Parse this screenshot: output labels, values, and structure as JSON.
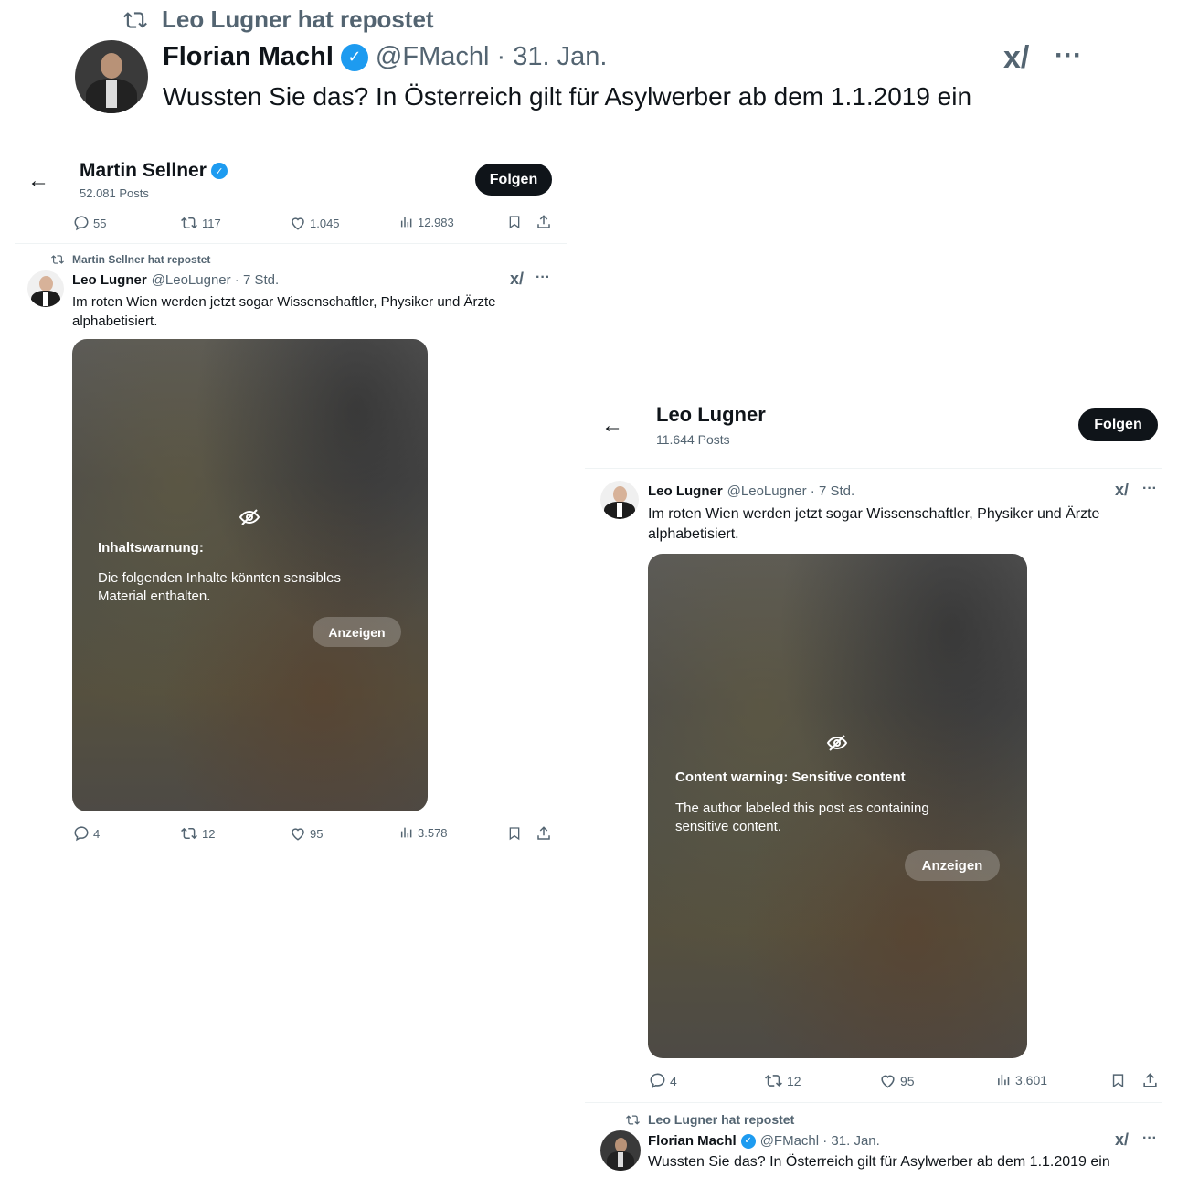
{
  "top": {
    "repost_label": "Leo Lugner hat repostet",
    "author_name": "Florian Machl",
    "handle_date": "@FMachl · 31. Jan.",
    "text": "Wussten Sie das? In Österreich gilt für Asylwerber ab dem 1.1.2019 ein"
  },
  "left": {
    "header_name": "Martin Sellner",
    "header_posts": "52.081 Posts",
    "follow_label": "Folgen",
    "first_actions": {
      "replies": "55",
      "reposts": "117",
      "likes": "1.045",
      "views": "12.983"
    },
    "repost_label": "Martin Sellner hat repostet",
    "author_name": "Leo Lugner",
    "handle_time": "@LeoLugner · 7 Std.",
    "text": "Im roten Wien werden jetzt sogar Wissenschaftler, Physiker und Ärzte alphabetisiert.",
    "warning_title": "Inhaltswarnung:",
    "warning_text": "Die folgenden Inhalte könnten sensibles Material enthalten.",
    "show_label": "Anzeigen",
    "actions": {
      "replies": "4",
      "reposts": "12",
      "likes": "95",
      "views": "3.578"
    }
  },
  "right": {
    "header_name": "Leo Lugner",
    "header_posts": "11.644 Posts",
    "follow_label": "Folgen",
    "author_name": "Leo Lugner",
    "handle_time": "@LeoLugner · 7 Std.",
    "text": "Im roten Wien werden jetzt sogar Wissenschaftler, Physiker und Ärzte alphabetisiert.",
    "warning_title": "Content warning: Sensitive content",
    "warning_text": "The author labeled this post as containing sensitive content.",
    "show_label": "Anzeigen",
    "actions": {
      "replies": "4",
      "reposts": "12",
      "likes": "95",
      "views": "3.601"
    },
    "repost_label": "Leo Lugner hat repostet",
    "bottom_author": "Florian Machl",
    "bottom_handle_date": "@FMachl · 31. Jan.",
    "bottom_text": "Wussten Sie das? In Österreich gilt für Asylwerber ab dem 1.1.2019 ein"
  },
  "icons": {
    "repost": "repost-icon",
    "reply": "reply-icon",
    "like": "heart-icon",
    "views": "views-icon",
    "bookmark": "bookmark-icon",
    "share": "share-icon",
    "grok": "grok-icon",
    "more": "more-icon",
    "back": "back-arrow-icon",
    "verified": "verified-badge-icon",
    "hidden": "eye-slash-icon"
  },
  "colors": {
    "verified": "#1d9bf0",
    "text": "#0f1419",
    "muted": "#536471",
    "follow_bg": "#0f1419"
  }
}
